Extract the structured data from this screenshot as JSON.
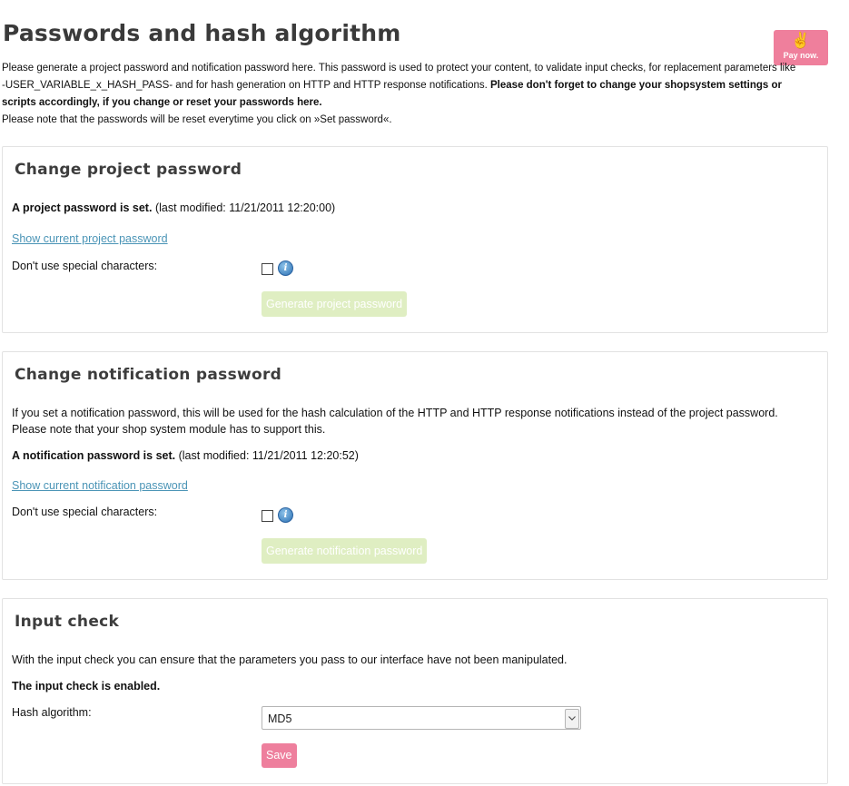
{
  "page": {
    "title": "Passwords and hash algorithm",
    "intro_line1": "Please generate a project password and notification password here. This password is used to protect your content, to validate input checks, for replacement parameters like -USER_VARIABLE_x_HASH_PASS- and for hash generation on HTTP and HTTP response notifications.",
    "intro_bold": "Please don't forget to change your shopsystem settings or scripts accordingly, if you change or reset your passwords here.",
    "intro_line2": "Please note that the passwords will be reset everytime you click on »Set password«."
  },
  "paynow": {
    "label": "Pay now.",
    "icon": "peace-hand-icon",
    "color": "#ef7f9c"
  },
  "project_password": {
    "heading": "Change project password",
    "status_bold": "A project password is set.",
    "status_modified": "(last modified: 11/21/2011 12:20:00)",
    "show_link": "Show current project password",
    "special_label": "Don't use special characters:",
    "generate_button": "Generate project password"
  },
  "notification_password": {
    "heading": "Change notification password",
    "description_1": "If you set a notification password, this will be used for the hash calculation of the HTTP and HTTP response notifications instead of the project password.",
    "description_2": "Please note that your shop system module has to support this.",
    "status_bold": "A notification password is set.",
    "status_modified": "(last modified: 11/21/2011 12:20:52)",
    "show_link": "Show current notification password",
    "special_label": "Don't use special characters:",
    "generate_button": "Generate notification password"
  },
  "input_check": {
    "heading": "Input check",
    "description": "With the input check you can ensure that the parameters you pass to our interface have not been manipulated.",
    "status": "The input check is enabled.",
    "hash_label": "Hash algorithm:",
    "hash_value": "MD5",
    "save_button": "Save"
  },
  "colors": {
    "accent_pink": "#ee7f9d",
    "disabled_green": "#dfeec2",
    "link_blue": "#4a94b6"
  }
}
